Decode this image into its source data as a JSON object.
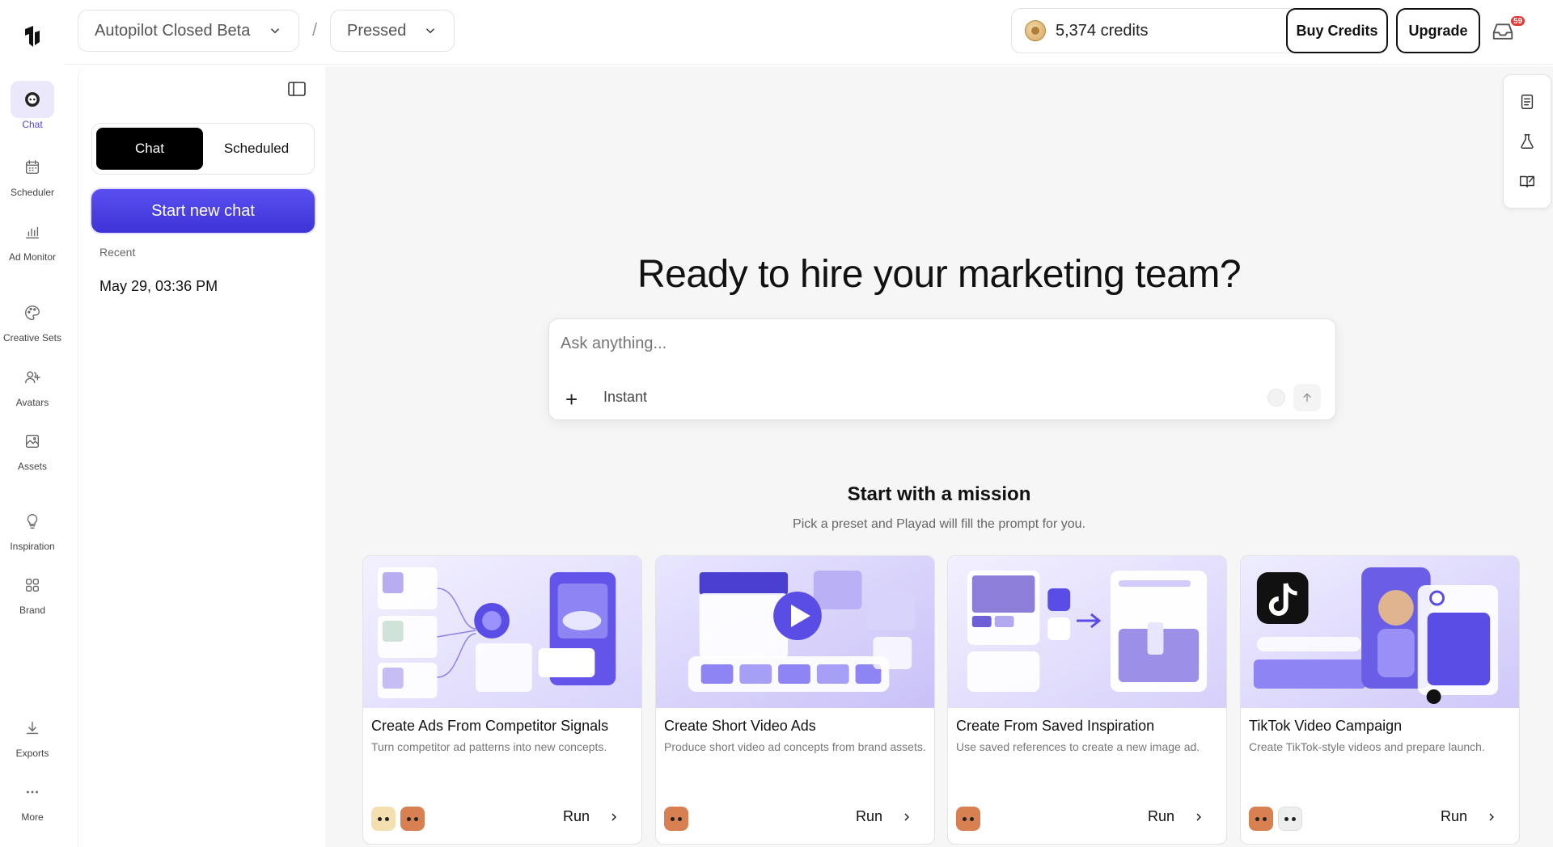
{
  "rail": {
    "items": [
      {
        "label": "Chat",
        "icon": "bot-icon"
      },
      {
        "label": "Scheduler",
        "icon": "calendar-icon"
      },
      {
        "label": "Ad Monitor",
        "icon": "bar-chart-icon"
      },
      {
        "label": "Creative Sets",
        "icon": "palette-icon"
      },
      {
        "label": "Avatars",
        "icon": "users-plus-icon"
      },
      {
        "label": "Assets",
        "icon": "image-icon"
      },
      {
        "label": "Inspiration",
        "icon": "lightbulb-icon"
      },
      {
        "label": "Brand",
        "icon": "grid-icon"
      },
      {
        "label": "Exports",
        "icon": "download-icon"
      },
      {
        "label": "More",
        "icon": "more-icon"
      }
    ]
  },
  "topbar": {
    "workspace": "Autopilot Closed Beta",
    "separator": "/",
    "project": "Pressed",
    "credits": "5,374 credits",
    "buy_credits": "Buy Credits",
    "upgrade": "Upgrade",
    "notification_count": "59"
  },
  "chat_panel": {
    "tabs": [
      "Chat",
      "Scheduled"
    ],
    "active_tab": "Chat",
    "new_chat": "Start new chat",
    "recent_label": "Recent",
    "history": [
      "May 29, 03:36 PM"
    ]
  },
  "main": {
    "headline": "Ready to hire your marketing team?",
    "ask_placeholder": "Ask anything...",
    "mode": "Instant",
    "missions_title": "Start with a mission",
    "missions_subtitle": "Pick a preset and Playad will fill the prompt for you.",
    "run_label": "Run",
    "cards": [
      {
        "title": "Create Ads From Competitor Signals",
        "description": "Turn competitor ad patterns into new concepts."
      },
      {
        "title": "Create Short Video Ads",
        "description": "Produce short video ad concepts from brand assets."
      },
      {
        "title": "Create From Saved Inspiration",
        "description": "Use saved references to create a new image ad."
      },
      {
        "title": "TikTok Video Campaign",
        "description": "Create TikTok-style videos and prepare launch."
      }
    ]
  },
  "colors": {
    "accent": "#4f46e5",
    "badge": "#e53935"
  }
}
